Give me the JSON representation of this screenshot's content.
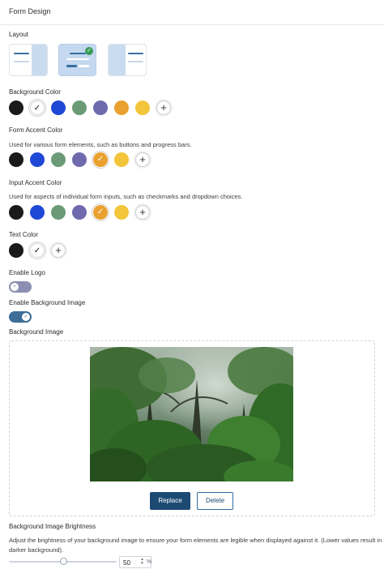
{
  "header": {
    "title": "Form Design"
  },
  "layout": {
    "label": "Layout",
    "selected_index": 1
  },
  "background_color": {
    "label": "Background Color",
    "swatches": [
      {
        "color": "#1a1a1a",
        "selected": false
      },
      {
        "color": "#ffffff",
        "selected": true
      },
      {
        "color": "#1f48d6",
        "selected": false
      },
      {
        "color": "#6a9b76",
        "selected": false
      },
      {
        "color": "#6f6aad",
        "selected": false
      },
      {
        "color": "#e9a12f",
        "selected": false
      },
      {
        "color": "#f3c53a",
        "selected": false
      }
    ]
  },
  "form_accent": {
    "label": "Form Accent Color",
    "description": "Used for various form elements, such as buttons and progress bars.",
    "swatches": [
      {
        "color": "#1a1a1a",
        "selected": false
      },
      {
        "color": "#1f48d6",
        "selected": false
      },
      {
        "color": "#6a9b76",
        "selected": false
      },
      {
        "color": "#6f6aad",
        "selected": false
      },
      {
        "color": "#e9a12f",
        "selected": true
      },
      {
        "color": "#f3c53a",
        "selected": false
      }
    ]
  },
  "input_accent": {
    "label": "Input Accent Color",
    "description": "Used for aspects of individual form inputs, such as checkmarks and dropdown choices.",
    "swatches": [
      {
        "color": "#1a1a1a",
        "selected": false
      },
      {
        "color": "#1f48d6",
        "selected": false
      },
      {
        "color": "#6a9b76",
        "selected": false
      },
      {
        "color": "#6f6aad",
        "selected": false
      },
      {
        "color": "#e9a12f",
        "selected": true
      },
      {
        "color": "#f3c53a",
        "selected": false
      }
    ]
  },
  "text_color": {
    "label": "Text Color",
    "swatches": [
      {
        "color": "#1a1a1a",
        "selected": false
      },
      {
        "color": "#ffffff",
        "selected": true
      }
    ]
  },
  "icons": {
    "add": "plus-icon",
    "check": "check-icon"
  },
  "glyphs": {
    "add": "+",
    "check": "✓"
  },
  "enable_logo": {
    "label": "Enable Logo",
    "on": false
  },
  "enable_bg_image": {
    "label": "Enable Background Image",
    "on": true
  },
  "bg_image": {
    "label": "Background Image",
    "replace_label": "Replace",
    "delete_label": "Delete"
  },
  "brightness": {
    "label": "Background Image Brightness",
    "description_line1": "Adjust the brightness of your background image to ensure your form elements are legible when displayed against it. (Lower values result in a",
    "description_line2": "darker background).",
    "value": "50",
    "unit": "%",
    "fraction": 0.5
  },
  "colors": {
    "primary": "#1d4a73",
    "toggle_on": "#3e6e98",
    "toggle_off": "#8a8fb2"
  }
}
